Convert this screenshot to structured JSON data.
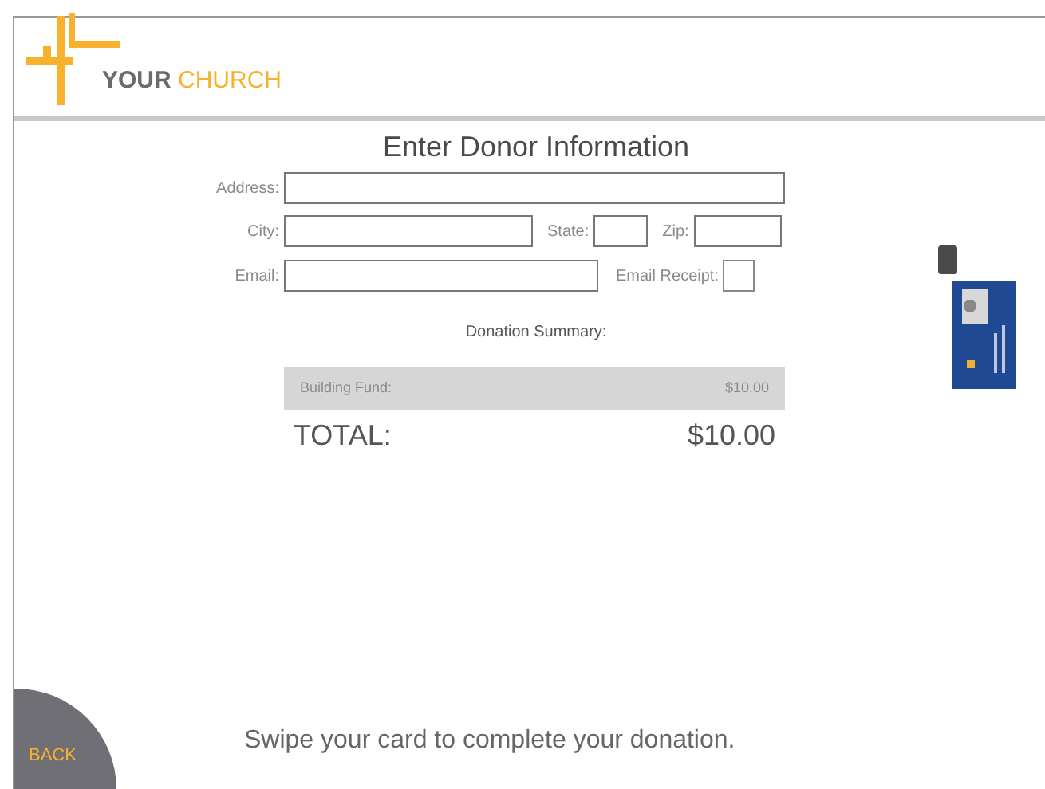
{
  "logo": {
    "word1": "YOUR",
    "word2": "CHURCH"
  },
  "title": "Enter Donor Information",
  "fields": [
    {
      "label": "Address:"
    },
    {
      "label": "City:"
    },
    {
      "label": "State:"
    },
    {
      "label": "Zip:"
    },
    {
      "label": "Email:"
    }
  ],
  "email_receipt": {
    "label": "Email Receipt:",
    "checked": false
  },
  "summary": {
    "heading": "Donation Summary:",
    "items": [
      {
        "name": "Building Fund:",
        "amount": "$10.00"
      }
    ],
    "total_label": "TOTAL:",
    "total_amount": "$10.00"
  },
  "back_button": "BACK",
  "instruction": "Swipe your card to complete your donation."
}
